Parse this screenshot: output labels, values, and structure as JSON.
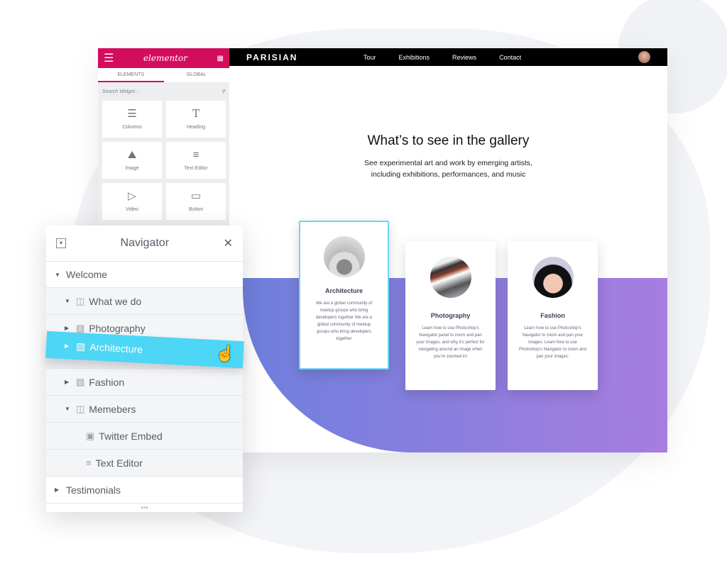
{
  "sidebar": {
    "logo": "elementor",
    "tabs": [
      "ELEMENTS",
      "GLOBAL"
    ],
    "search_placeholder": "Search Widget...",
    "widgets": [
      {
        "label": "Columns",
        "icon": "columns-icon",
        "glyph": "☰"
      },
      {
        "label": "Heading",
        "icon": "heading-icon",
        "glyph": "T"
      },
      {
        "label": "Image",
        "icon": "image-icon",
        "glyph": "🖼"
      },
      {
        "label": "Text Editor",
        "icon": "text-editor-icon",
        "glyph": "≡"
      },
      {
        "label": "Video",
        "icon": "video-icon",
        "glyph": "▷"
      },
      {
        "label": "Button",
        "icon": "button-icon",
        "glyph": "▭"
      }
    ]
  },
  "site": {
    "brand": "PARISIAN",
    "nav": [
      "Tour",
      "Exhibitions",
      "Reviews",
      "Contact"
    ],
    "title": "What’s to see in the gallery",
    "subtitle_1": "See experimental art and work by emerging artists,",
    "subtitle_2": "including exhibitions, performances, and music",
    "cards": [
      {
        "title": "Architecture",
        "text": "We are a global community of meetup groups who bring developers together We are a global community of meetup groups who bring developers together"
      },
      {
        "title": "Photography",
        "text": "Learn how to use Photoshop’s Navigator panel to zoom and pan your images, and why it’s perfect for navigating around an image when you’re zoomed in!"
      },
      {
        "title": "Fashion",
        "text": "Learn how to use Photoshop’s Navigator to zoom and pan your images. Learn how to use Photoshop’s Navigator to zoom and pan your images."
      }
    ]
  },
  "navigator": {
    "title": "Navigator",
    "items": [
      "Welcome",
      "What we do",
      "Photography",
      "Architecture",
      "Fashion",
      "Memebers",
      "Twitter Embed",
      "Text Editor",
      "Testimonials"
    ]
  },
  "colors": {
    "brand": "#d30c5c",
    "highlight": "#4dd6f5",
    "band_start": "#6f7fdd",
    "band_end": "#a77de0"
  }
}
